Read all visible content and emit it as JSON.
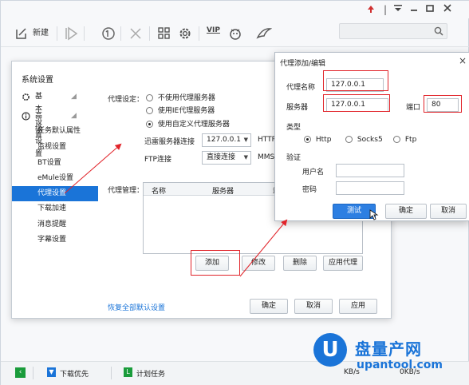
{
  "titlebar": {
    "controls": [
      "pin-icon",
      "menu-icon",
      "minimize-icon",
      "maximize-icon",
      "close-icon"
    ]
  },
  "toolbar": {
    "new_label": "新建",
    "vip_label": "VIP"
  },
  "settings": {
    "sidebar_title": "系统设置",
    "categories": [
      {
        "label": "基本设置"
      },
      {
        "label": "高级设置"
      }
    ],
    "items": [
      {
        "label": "任务默认属性"
      },
      {
        "label": "监视设置"
      },
      {
        "label": "BT设置"
      },
      {
        "label": "eMule设置"
      },
      {
        "label": "代理设置"
      },
      {
        "label": "下载加速"
      },
      {
        "label": "消息提醒"
      },
      {
        "label": "字幕设置"
      }
    ],
    "proxy_setting_label": "代理设定：",
    "options": [
      {
        "label": "不使用代理服务器"
      },
      {
        "label": "使用IE代理服务器"
      },
      {
        "label": "使用自定义代理服务器"
      }
    ],
    "xunlei_server_label": "迅雷服务器连接",
    "xunlei_server_value": "127.0.0.1",
    "http_label": "HTTP",
    "ftp_label": "FTP连接",
    "ftp_value": "直接连接",
    "mms_label": "MMS,",
    "proxy_manage_label": "代理管理：",
    "columns": [
      "名称",
      "服务器",
      "端"
    ],
    "add_button": "添加",
    "edit_button": "修改",
    "delete_button": "删除",
    "apply_proxy_button": "应用代理",
    "restore_link": "恢复全部默认设置",
    "ok_button": "确定",
    "cancel_button": "取消",
    "apply_button": "应用"
  },
  "proxy_dialog": {
    "title": "代理添加/编辑",
    "name_label": "代理名称",
    "name_value": "127.0.0.1",
    "server_label": "服务器",
    "server_value": "127.0.0.1",
    "port_label": "端口",
    "port_value": "80",
    "type_label": "类型",
    "types": [
      {
        "label": "Http"
      },
      {
        "label": "Socks5"
      },
      {
        "label": "Ftp"
      }
    ],
    "auth_label": "验证",
    "username_label": "用户名",
    "password_label": "密码",
    "test_button": "测试",
    "ok_button": "确定",
    "cancel_button": "取消"
  },
  "statusbar": {
    "download_priority": "下载优先",
    "scheduled_tasks": "计划任务",
    "speed_left": "KB/s",
    "speed_right": "0KB/s"
  },
  "watermark": {
    "brand_text": "upantool.com"
  },
  "colors": {
    "accent": "#1a74d8",
    "highlight_red": "#e1242a",
    "status_green": "#1a9c3b"
  }
}
